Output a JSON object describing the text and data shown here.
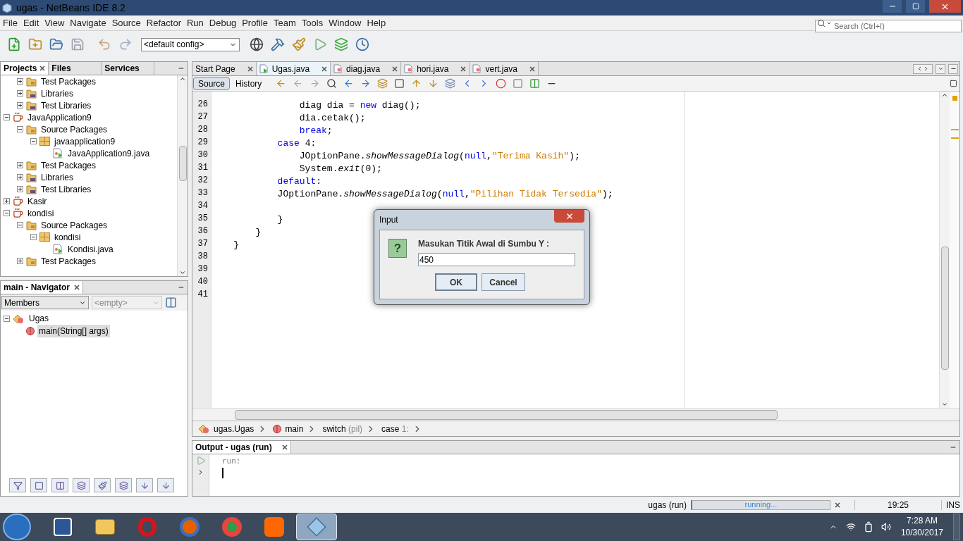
{
  "window": {
    "title": "ugas - NetBeans IDE 8.2"
  },
  "menu": [
    "File",
    "Edit",
    "View",
    "Navigate",
    "Source",
    "Refactor",
    "Run",
    "Debug",
    "Profile",
    "Team",
    "Tools",
    "Window",
    "Help"
  ],
  "toolbar": {
    "config": "<default config>",
    "search_placeholder": "Search (Ctrl+I)"
  },
  "projects_panel": {
    "tabs": [
      {
        "label": "Projects",
        "selected": true
      },
      {
        "label": "Files",
        "selected": false
      },
      {
        "label": "Services",
        "selected": false
      }
    ],
    "tree": [
      {
        "kind": "group",
        "children": [
          {
            "label": "Test Packages",
            "kind": "test-folder",
            "expanded": false
          },
          {
            "label": "Libraries",
            "kind": "library-folder",
            "expanded": false
          },
          {
            "label": "Test Libraries",
            "kind": "library-folder",
            "expanded": false
          }
        ]
      },
      {
        "label": "JavaApplication9",
        "kind": "project",
        "expanded": true,
        "children": [
          {
            "label": "Source Packages",
            "kind": "source-folder",
            "expanded": true,
            "children": [
              {
                "label": "javaapplication9",
                "kind": "package",
                "expanded": true,
                "children": [
                  {
                    "label": "JavaApplication9.java",
                    "kind": "java-file"
                  }
                ]
              }
            ]
          },
          {
            "label": "Test Packages",
            "kind": "test-folder",
            "expanded": false
          },
          {
            "label": "Libraries",
            "kind": "library-folder",
            "expanded": false
          },
          {
            "label": "Test Libraries",
            "kind": "library-folder",
            "expanded": false
          }
        ]
      },
      {
        "label": "Kasir",
        "kind": "project",
        "expanded": false
      },
      {
        "label": "kondisi",
        "kind": "project",
        "expanded": true,
        "children": [
          {
            "label": "Source Packages",
            "kind": "source-folder",
            "expanded": true,
            "children": [
              {
                "label": "kondisi",
                "kind": "package",
                "expanded": true,
                "children": [
                  {
                    "label": "Kondisi.java",
                    "kind": "java-file"
                  }
                ]
              }
            ]
          },
          {
            "label": "Test Packages",
            "kind": "test-folder",
            "expanded": false
          }
        ]
      }
    ]
  },
  "navigator": {
    "title": "main - Navigator",
    "filter": "Members",
    "second_filter": "<empty>",
    "tree": [
      {
        "label": "Ugas",
        "kind": "class",
        "expanded": true,
        "selected": false,
        "children": [
          {
            "label": "main(String[] args)",
            "kind": "method",
            "selected": true
          }
        ]
      }
    ]
  },
  "editor": {
    "tabs": [
      {
        "label": "Start Page",
        "kind": "page",
        "selected": false
      },
      {
        "label": "Ugas.java",
        "kind": "main-file",
        "selected": true
      },
      {
        "label": "diag.java",
        "kind": "file",
        "selected": false
      },
      {
        "label": "hori.java",
        "kind": "file",
        "selected": false
      },
      {
        "label": "vert.java",
        "kind": "file",
        "selected": false
      }
    ],
    "views": [
      {
        "label": "Source",
        "selected": true
      },
      {
        "label": "History",
        "selected": false
      }
    ],
    "lines": [
      {
        "number": "26",
        "tokens": [
          {
            "kind": "plain",
            "text": "                diag dia = "
          },
          {
            "kind": "keyword",
            "text": "new"
          },
          {
            "kind": "plain",
            "text": " diag();"
          }
        ]
      },
      {
        "number": "27",
        "tokens": [
          {
            "kind": "plain",
            "text": "                dia.cetak();"
          }
        ]
      },
      {
        "number": "28",
        "tokens": [
          {
            "kind": "keyword",
            "text": "                break"
          },
          {
            "kind": "plain",
            "text": ";"
          }
        ]
      },
      {
        "number": "29",
        "tokens": [
          {
            "kind": "keyword",
            "text": "            case"
          },
          {
            "kind": "plain",
            "text": " 4:"
          }
        ]
      },
      {
        "number": "30",
        "tokens": [
          {
            "kind": "plain",
            "text": "                JOptionPane."
          },
          {
            "kind": "method",
            "text": "showMessageDialog"
          },
          {
            "kind": "plain",
            "text": "("
          },
          {
            "kind": "keyword",
            "text": "null"
          },
          {
            "kind": "plain",
            "text": ","
          },
          {
            "kind": "string",
            "text": "\"Terima Kasih\""
          },
          {
            "kind": "plain",
            "text": ");"
          }
        ]
      },
      {
        "number": "31",
        "tokens": [
          {
            "kind": "plain",
            "text": "                System."
          },
          {
            "kind": "method",
            "text": "exit"
          },
          {
            "kind": "plain",
            "text": "(0);"
          }
        ]
      },
      {
        "number": "32",
        "tokens": [
          {
            "kind": "keyword",
            "text": "            default"
          },
          {
            "kind": "plain",
            "text": ":"
          }
        ]
      },
      {
        "number": "33",
        "tokens": [
          {
            "kind": "plain",
            "text": "            JOptionPane."
          },
          {
            "kind": "method",
            "text": "showMessageDialog"
          },
          {
            "kind": "plain",
            "text": "("
          },
          {
            "kind": "keyword",
            "text": "null"
          },
          {
            "kind": "plain",
            "text": ","
          },
          {
            "kind": "string",
            "text": "\"Pilihan Tidak Tersedia\""
          },
          {
            "kind": "plain",
            "text": ");"
          }
        ]
      },
      {
        "number": "34"
      },
      {
        "number": "35",
        "tokens": [
          {
            "kind": "plain",
            "text": "            }"
          }
        ]
      },
      {
        "number": "36",
        "tokens": [
          {
            "kind": "plain",
            "text": "        }"
          }
        ]
      },
      {
        "number": "37",
        "tokens": [
          {
            "kind": "plain",
            "text": "    }"
          }
        ]
      },
      {
        "number": "38"
      },
      {
        "number": "39"
      },
      {
        "number": "40"
      },
      {
        "number": "41"
      }
    ],
    "breadcrumb": [
      {
        "kind": "class",
        "text": "ugas.Ugas"
      },
      {
        "kind": "method",
        "text": "main"
      },
      {
        "kind": "plain",
        "text": "switch",
        "detail": "(pil)"
      },
      {
        "kind": "plain",
        "text": "case",
        "detail": "1:"
      }
    ]
  },
  "output": {
    "title": "Output - ugas (run)",
    "lines": [
      "run:"
    ]
  },
  "status_bar": {
    "task": "ugas (run)",
    "progress": "running...",
    "level": 1,
    "position": "19:25",
    "mode": "INS"
  },
  "dialog": {
    "title": "Input",
    "icon_text": "?",
    "message": "Masukan Titik Awal di Sumbu Y :",
    "value": "450",
    "buttons": [
      {
        "label": "OK",
        "default": true
      },
      {
        "label": "Cancel",
        "default": false
      }
    ]
  },
  "taskbar": {
    "apps": [
      {
        "kind": "word",
        "selected": false
      },
      {
        "kind": "explorer",
        "selected": false
      },
      {
        "kind": "opera",
        "selected": false
      },
      {
        "kind": "firefox",
        "selected": false
      },
      {
        "kind": "chrome",
        "selected": false
      },
      {
        "kind": "mi",
        "selected": false
      },
      {
        "kind": "netbeans",
        "selected": true
      }
    ],
    "time": "7:28 AM",
    "date": "10/30/2017"
  }
}
